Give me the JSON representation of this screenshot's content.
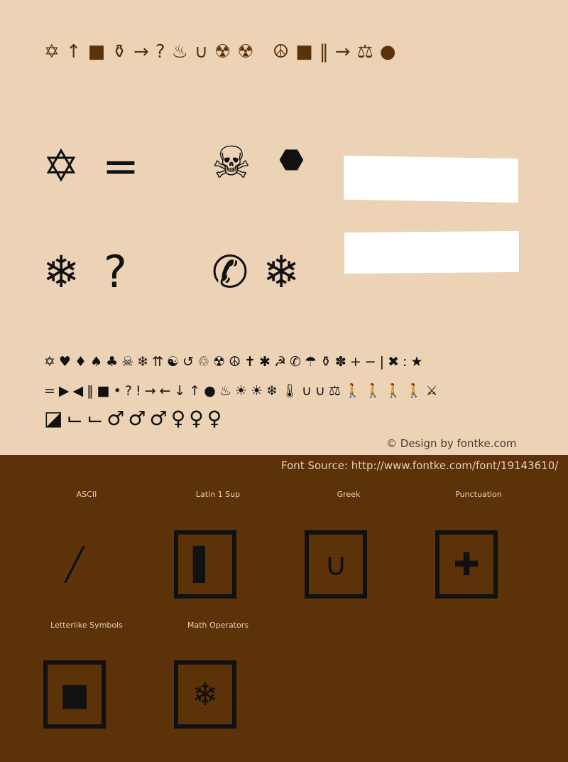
{
  "header_glyphs": [
    "✡",
    "↑",
    "■",
    "⚱",
    "→",
    "?",
    "♨",
    "∪",
    "☢",
    "☢",
    " ",
    "☮",
    "■",
    "‖",
    "→",
    "⚖",
    "●"
  ],
  "large_glyphs": {
    "row1": [
      "✡",
      "=",
      "☠",
      "⬣"
    ],
    "row2": [
      "❄",
      "?",
      "✆",
      "❄"
    ]
  },
  "charset_rows": [
    [
      "✡",
      "♥",
      "♦",
      "♠",
      "♣",
      "☠",
      "❄",
      "⇈",
      "☯",
      "↺",
      "♲",
      "☢",
      "☮",
      "✝",
      "✱",
      "☭",
      "✆",
      "☂",
      "⚱",
      "✽",
      "+",
      "−",
      "|",
      "✖",
      ":",
      "★"
    ],
    [
      "=",
      "▶",
      "◀",
      "‖",
      "■",
      "•",
      "?",
      "!",
      "→",
      "←",
      "↓",
      "↑",
      "●",
      "♨",
      "☀",
      "☀",
      "❄",
      "🌡",
      "∪",
      "∪",
      "⚖",
      "🚶",
      "🚶",
      "🚶",
      "🚶",
      "⚔"
    ],
    [
      "◪",
      "⌙",
      "⌙",
      "♂",
      "♂",
      "♂",
      "♀",
      "♀",
      "♀"
    ]
  ],
  "credit": "© Design by fontke.com",
  "font_source": "Font Source: http://www.fontke.com/font/19143610/",
  "categories": [
    {
      "label": "ASCII",
      "glyph": "╱"
    },
    {
      "label": "Latin 1 Sup",
      "glyph": "▌"
    },
    {
      "label": "Greek",
      "glyph": "∪"
    },
    {
      "label": "Punctuation",
      "glyph": "✚"
    },
    {
      "label": "Letterlike Symbols",
      "glyph": "■"
    },
    {
      "label": "Math Operators",
      "glyph": "❄"
    }
  ],
  "colors": {
    "background_top": "#ecd3b6",
    "background_bottom": "#5c3209"
  }
}
